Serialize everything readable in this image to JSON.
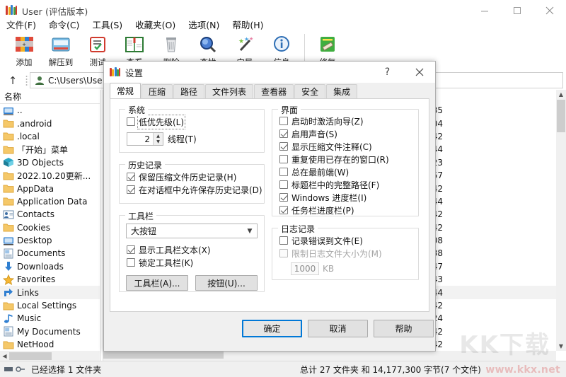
{
  "main_window": {
    "title": "User (评估版本)",
    "app_icon": "winrar-books-icon",
    "window_controls": {
      "minimize": "minimize-icon",
      "maximize": "maximize-icon",
      "close": "close-icon"
    },
    "menu": [
      {
        "label": "文件(F)"
      },
      {
        "label": "命令(C)"
      },
      {
        "label": "工具(S)"
      },
      {
        "label": "收藏夹(O)"
      },
      {
        "label": "选项(N)"
      },
      {
        "label": "帮助(H)"
      }
    ],
    "toolbar": [
      {
        "label": "添加",
        "icon": "add-archive-icon"
      },
      {
        "label": "解压到",
        "icon": "extract-to-icon"
      },
      {
        "label": "测试",
        "icon": "test-archive-icon"
      },
      {
        "label": "查看",
        "icon": "view-book-icon"
      },
      {
        "label": "删除",
        "icon": "delete-trash-icon"
      },
      {
        "label": "查找",
        "icon": "find-magnifier-icon"
      },
      {
        "label": "向导",
        "icon": "wizard-wand-icon"
      },
      {
        "label": "信息",
        "icon": "info-circle-icon"
      },
      {
        "label": "修复",
        "icon": "repair-icon"
      }
    ],
    "address_bar": {
      "up_label": "↑",
      "icon": "user-folder-icon",
      "value": "C:\\Users\\Use",
      "dropdown": "chevron-down-icon"
    },
    "left_pane": {
      "header": "名称",
      "items": [
        {
          "name": "..",
          "icon": "up-folder-icon",
          "selected": false
        },
        {
          "name": ".android",
          "icon": "folder-icon",
          "selected": false
        },
        {
          "name": ".local",
          "icon": "folder-icon",
          "selected": false
        },
        {
          "name": "「开始」菜单",
          "icon": "folder-icon",
          "selected": false
        },
        {
          "name": "3D Objects",
          "icon": "3d-objects-icon",
          "selected": false
        },
        {
          "name": "2022.10.20更新...",
          "icon": "folder-icon",
          "selected": false
        },
        {
          "name": "AppData",
          "icon": "folder-icon",
          "selected": false
        },
        {
          "name": "Application Data",
          "icon": "folder-icon",
          "selected": false
        },
        {
          "name": "Contacts",
          "icon": "contacts-icon",
          "selected": false
        },
        {
          "name": "Cookies",
          "icon": "folder-icon",
          "selected": false
        },
        {
          "name": "Desktop",
          "icon": "desktop-icon",
          "selected": false
        },
        {
          "name": "Documents",
          "icon": "documents-icon",
          "selected": false
        },
        {
          "name": "Downloads",
          "icon": "downloads-icon",
          "selected": false
        },
        {
          "name": "Favorites",
          "icon": "favorites-star-icon",
          "selected": false
        },
        {
          "name": "Links",
          "icon": "links-icon",
          "selected": true
        },
        {
          "name": "Local Settings",
          "icon": "folder-icon",
          "selected": false
        },
        {
          "name": "Music",
          "icon": "music-note-icon",
          "selected": false
        },
        {
          "name": "My Documents",
          "icon": "documents-icon",
          "selected": false
        },
        {
          "name": "NetHood",
          "icon": "folder-icon",
          "selected": false
        }
      ]
    },
    "right_pane": {
      "rows": [
        {
          "time": "4:35",
          "selected": false
        },
        {
          "time": "5:04",
          "selected": false
        },
        {
          "time": ":42",
          "selected": false
        },
        {
          "time": ":44",
          "selected": false
        },
        {
          "time": "5:23",
          "selected": false
        },
        {
          "time": "4:57",
          "selected": false
        },
        {
          "time": ":42",
          "selected": false
        },
        {
          "time": ":44",
          "selected": false
        },
        {
          "time": ":42",
          "selected": false
        },
        {
          "time": ":42",
          "selected": false
        },
        {
          "time": "7:08",
          "selected": false
        },
        {
          "time": "7:38",
          "selected": false
        },
        {
          "time": "6:47",
          "selected": false
        },
        {
          "time": "6:43",
          "selected": false
        },
        {
          "time": ":44",
          "selected": true
        },
        {
          "time": ":42",
          "selected": false
        },
        {
          "time": "5:24",
          "selected": false
        },
        {
          "time": ":42",
          "selected": false
        },
        {
          "time": ":42",
          "selected": false
        }
      ]
    },
    "status_bar": {
      "left": "已经选择 1 文件夹",
      "right": "总计 27 文件夹 和 14,177,300 字节(7 个文件)",
      "watermark": "www.kkx.net",
      "watermark_big": "KK下载"
    }
  },
  "dialog": {
    "title": "设置",
    "icon": "winrar-books-icon",
    "help_button": "?",
    "close_button": "close-icon",
    "tabs": [
      {
        "label": "常规",
        "active": true
      },
      {
        "label": "压缩",
        "active": false
      },
      {
        "label": "路径",
        "active": false
      },
      {
        "label": "文件列表",
        "active": false
      },
      {
        "label": "查看器",
        "active": false
      },
      {
        "label": "安全",
        "active": false
      },
      {
        "label": "集成",
        "active": false
      }
    ],
    "system_group": {
      "title": "系统",
      "low_priority": {
        "label": "低优先级(L)",
        "accel": "(L)",
        "checked": false,
        "focused": true
      },
      "threads": {
        "value": "2",
        "label": "线程(T)",
        "accel": "(T)"
      }
    },
    "history_group": {
      "title": "历史记录",
      "items": [
        {
          "label": "保留压缩文件历史记录(H)",
          "checked": true
        },
        {
          "label": "在对话框中允许保存历史记录(D)",
          "checked": true
        }
      ]
    },
    "toolbar_group": {
      "title": "工具栏",
      "combo_value": "大按钮",
      "items": [
        {
          "label": "显示工具栏文本(X)",
          "checked": true
        },
        {
          "label": "锁定工具栏(K)",
          "checked": false
        }
      ],
      "buttons": [
        {
          "label": "工具栏(A)..."
        },
        {
          "label": "按钮(U)..."
        }
      ]
    },
    "interface_group": {
      "title": "界面",
      "items": [
        {
          "label": "启动时激活向导(Z)",
          "checked": false
        },
        {
          "label": "启用声音(S)",
          "checked": true
        },
        {
          "label": "显示压缩文件注释(C)",
          "checked": true
        },
        {
          "label": "重复使用已存在的窗口(R)",
          "checked": false
        },
        {
          "label": "总在最前端(W)",
          "checked": false
        },
        {
          "label": "标题栏中的完整路径(F)",
          "checked": false
        },
        {
          "label": "Windows 进度栏(I)",
          "checked": true
        },
        {
          "label": "任务栏进度栏(P)",
          "checked": true
        }
      ]
    },
    "log_group": {
      "title": "日志记录",
      "log_errors": {
        "label": "记录错误到文件(E)",
        "checked": false,
        "disabled": false
      },
      "limit_size": {
        "label": "限制日志文件大小为(M)",
        "checked": false,
        "disabled": true
      },
      "size_value": "1000",
      "size_unit": "KB"
    },
    "footer_buttons": [
      {
        "label": "确定",
        "default": true
      },
      {
        "label": "取消",
        "default": false
      },
      {
        "label": "帮助",
        "default": false
      }
    ]
  },
  "colors": {
    "accent": "#0078d7",
    "dialog_bg": "#f0f0f0",
    "accel_text": "#1f5fa8",
    "selection": "#f2f2f2"
  }
}
